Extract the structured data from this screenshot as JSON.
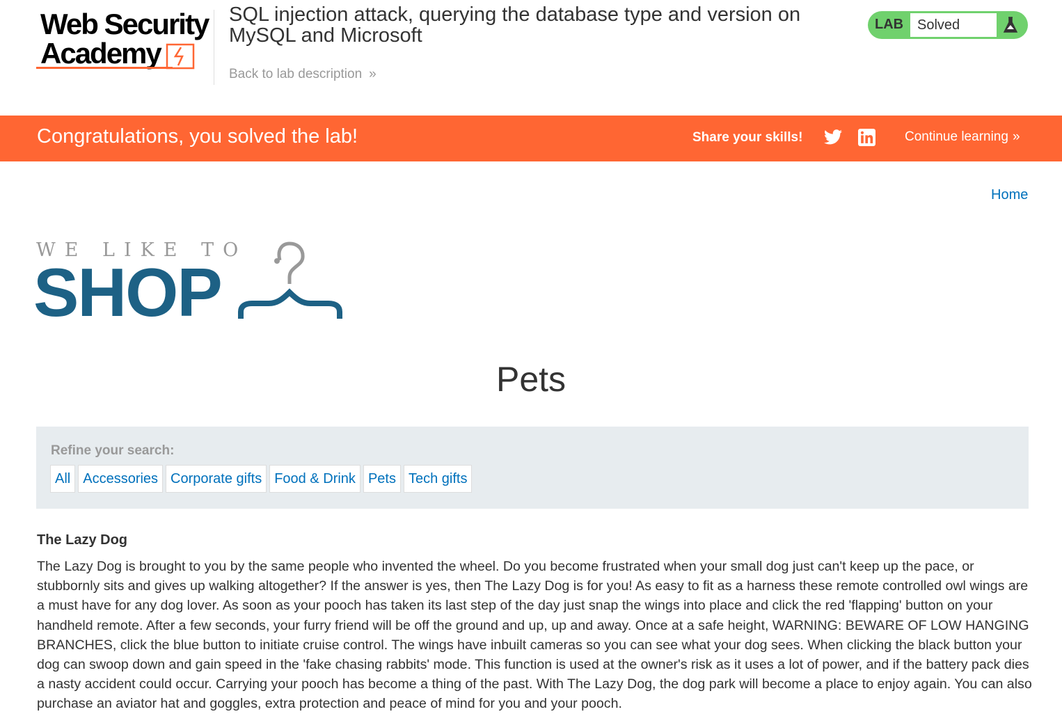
{
  "academy": {
    "logo_line1": "Web Security",
    "logo_line2": "Academy",
    "lab_title": "SQL injection attack, querying the database type and version on MySQL and Microsoft",
    "back_link": "Back to lab description",
    "lab_badge": "LAB",
    "lab_state": "Solved"
  },
  "banner": {
    "message": "Congratulations, you solved the lab!",
    "share": "Share your skills!",
    "continue": "Continue learning"
  },
  "shop": {
    "nav_home": "Home",
    "logo_tagline": "WE LIKE TO",
    "logo_word": "SHOP",
    "heading": "Pets",
    "refine_label": "Refine your search:",
    "categories": [
      "All",
      "Accessories",
      "Corporate gifts",
      "Food & Drink",
      "Pets",
      "Tech gifts"
    ]
  },
  "product": {
    "name": "The Lazy Dog",
    "description": "The Lazy Dog is brought to you by the same people who invented the wheel. Do you become frustrated when your small dog just can't keep up the pace, or stubbornly sits and gives up walking altogether? If the answer is yes, then The Lazy Dog is for you! As easy to fit as a harness these remote controlled owl wings are a must have for any dog lover. As soon as your pooch has taken its last step of the day just snap the wings into place and click the red 'flapping' button on your handheld remote. After a few seconds, your furry friend will be off the ground and up, up and away. Once at a safe height, WARNING: BEWARE OF LOW HANGING BRANCHES, click the blue button to initiate cruise control. The wings have inbuilt cameras so you can see what your dog sees. When clicking the black button your dog can swoop down and gain speed in the 'fake chasing rabbits' mode. This function is used at the owner's risk as it uses a lot of power, and if the battery pack dies a nasty accident could occur. Carrying your pooch has become a thing of the past. With The Lazy Dog, the dog park will become a place to enjoy again. You can also purchase an aviator hat and goggles, extra protection and peace of mind for you and your pooch."
  },
  "icons": {
    "lab_status": "flask-icon",
    "back_chevron": "double-chevron-right-icon",
    "share1": "twitter-icon",
    "share2": "linkedin-icon",
    "continue_chevron": "double-chevron-right-icon",
    "logo_bolt": "lightning-bolt-icon",
    "shop_hanger": "coat-hanger-icon"
  },
  "colors": {
    "accent_orange": "#ff6633",
    "solved_green": "#70d16d",
    "link_blue": "#0071bc",
    "shop_blue": "#1d6185",
    "filter_bg": "#e7ecef"
  }
}
